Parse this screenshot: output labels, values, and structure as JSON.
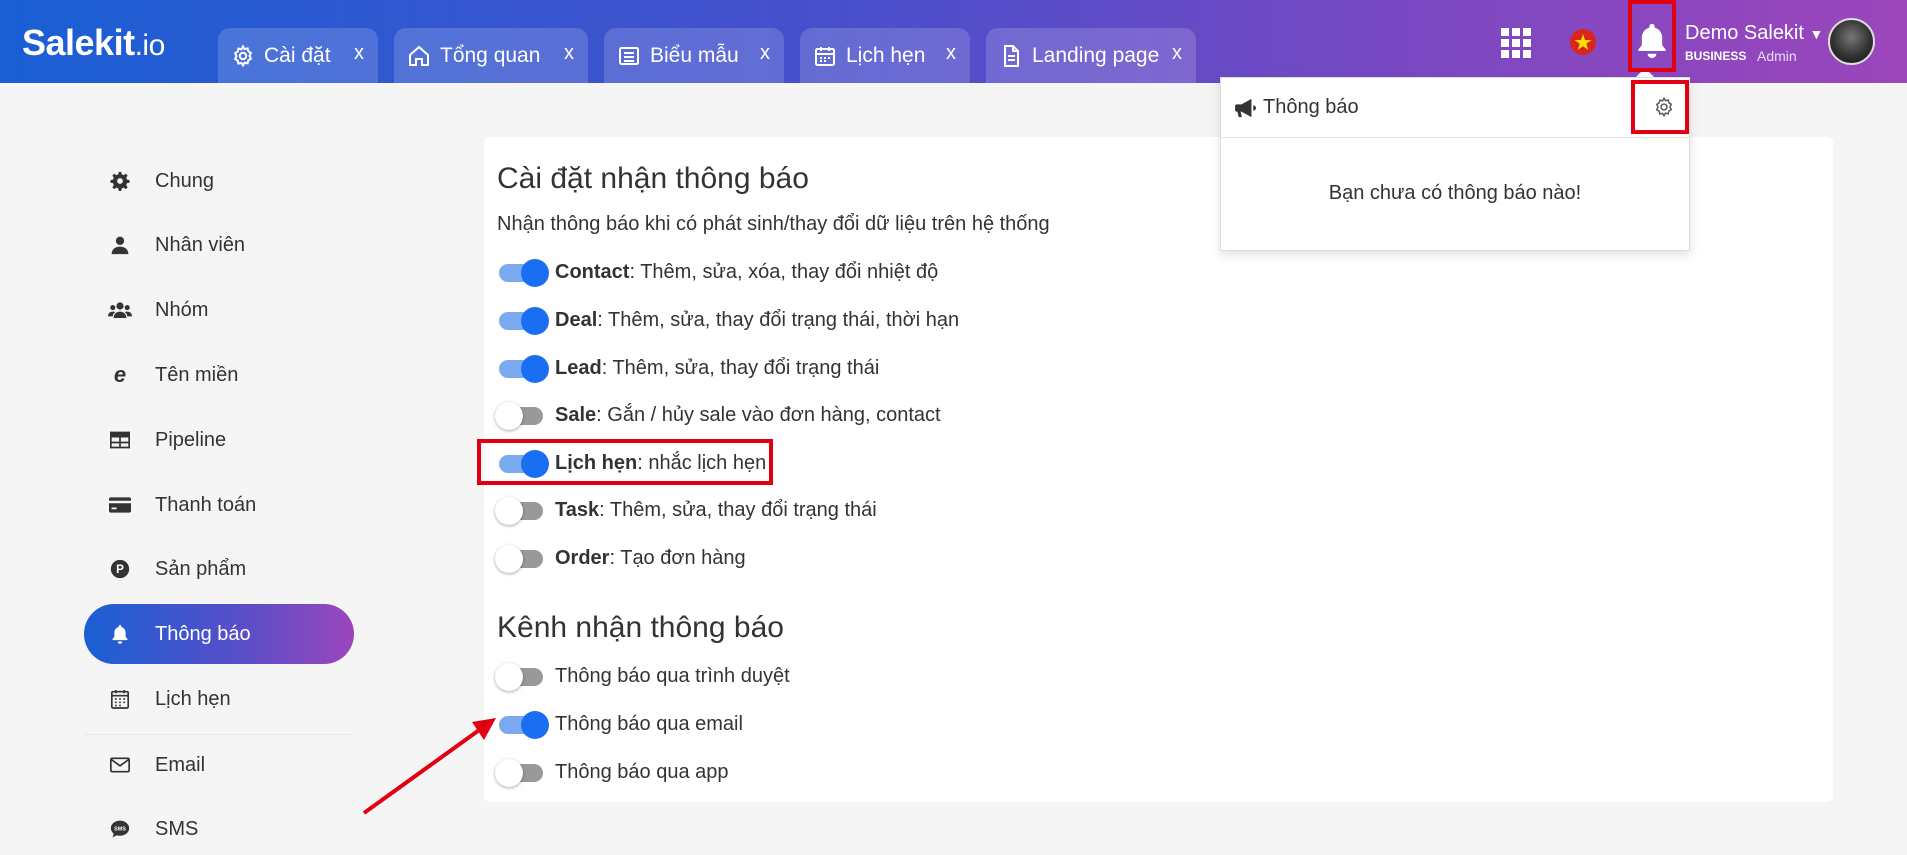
{
  "app": {
    "logo_main": "Salekit",
    "logo_suffix": ".io"
  },
  "tabs": [
    {
      "label": "Cài đặt",
      "icon": "gear-icon",
      "close": "x"
    },
    {
      "label": "Tổng quan",
      "icon": "home-icon",
      "close": "x"
    },
    {
      "label": "Biểu mẫu",
      "icon": "list-icon",
      "close": "x"
    },
    {
      "label": "Lịch hẹn",
      "icon": "calendar-icon",
      "close": "x"
    },
    {
      "label": "Landing page",
      "icon": "document-icon",
      "close": "x"
    }
  ],
  "header": {
    "user_name": "Demo Salekit",
    "plan": "BUSINESS",
    "role": "Admin",
    "language_flag": "vietnam-flag-icon"
  },
  "sidebar": {
    "items": [
      {
        "label": "Chung",
        "icon": "gear-icon"
      },
      {
        "label": "Nhân viên",
        "icon": "user-icon"
      },
      {
        "label": "Nhóm",
        "icon": "users-icon"
      },
      {
        "label": "Tên miền",
        "icon": "globe-e-icon"
      },
      {
        "label": "Pipeline",
        "icon": "table-icon"
      },
      {
        "label": "Thanh toán",
        "icon": "credit-card-icon"
      },
      {
        "label": "Sản phẩm",
        "icon": "product-p-icon"
      },
      {
        "label": "Thông báo",
        "icon": "bell-icon",
        "active": true
      },
      {
        "label": "Lịch hẹn",
        "icon": "calendar-icon"
      },
      {
        "label": "Email",
        "icon": "mail-icon"
      },
      {
        "label": "SMS",
        "icon": "sms-icon"
      }
    ]
  },
  "settings": {
    "title": "Cài đặt nhận thông báo",
    "description": "Nhận thông báo khi có phát sinh/thay đổi dữ liệu trên hệ thống",
    "items": [
      {
        "key": "Contact",
        "text": ": Thêm, sửa, xóa, thay đổi nhiệt độ",
        "enabled": true
      },
      {
        "key": "Deal",
        "text": ": Thêm, sửa, thay đổi trạng thái, thời hạn",
        "enabled": true
      },
      {
        "key": "Lead",
        "text": ": Thêm, sửa, thay đổi trạng thái",
        "enabled": true
      },
      {
        "key": "Sale",
        "text": ": Gắn / hủy sale vào đơn hàng, contact",
        "enabled": false
      },
      {
        "key": "Lịch hẹn",
        "text": ": nhắc lịch hẹn",
        "enabled": true
      },
      {
        "key": "Task",
        "text": ": Thêm, sửa, thay đổi trạng thái",
        "enabled": false
      },
      {
        "key": "Order",
        "text": ": Tạo đơn hàng",
        "enabled": false
      }
    ]
  },
  "channels": {
    "title": "Kênh nhận thông báo",
    "items": [
      {
        "label": "Thông báo qua trình duyệt",
        "enabled": false
      },
      {
        "label": "Thông báo qua email",
        "enabled": true
      },
      {
        "label": "Thông báo qua app",
        "enabled": false
      }
    ]
  },
  "notification_panel": {
    "title": "Thông báo",
    "empty_message": "Bạn chưa có thông báo nào!"
  },
  "colors": {
    "accent": "#1a6ef2",
    "gradient_start": "#1a5fd4",
    "gradient_end": "#9c46bb",
    "highlight": "#e00012"
  }
}
